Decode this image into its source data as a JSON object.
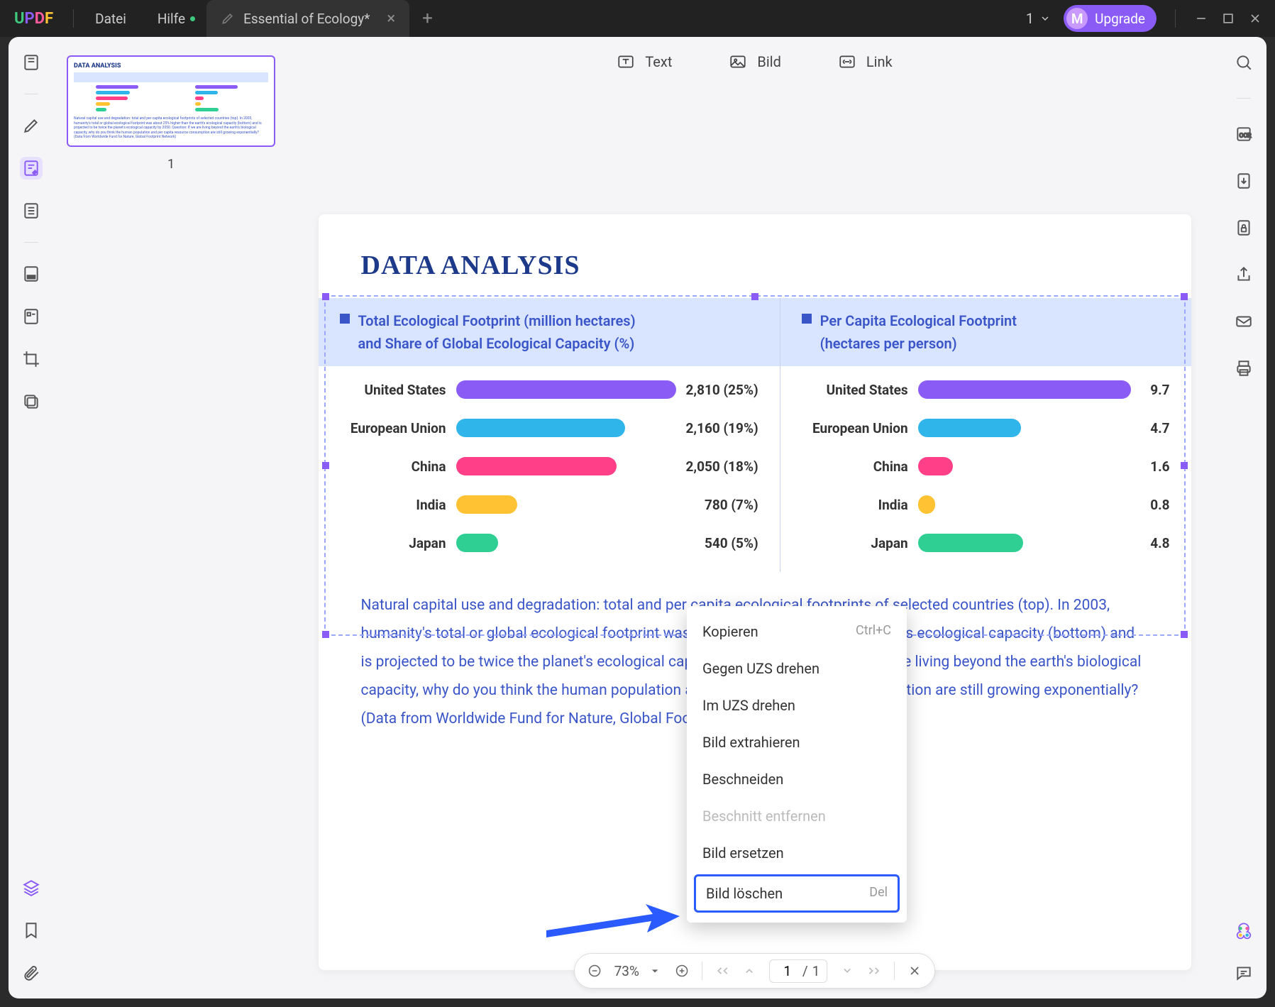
{
  "titlebar": {
    "menu_file": "Datei",
    "menu_help": "Hilfe",
    "tab_title": "Essential of Ecology*",
    "page_indicator": "1",
    "upgrade_avatar": "M",
    "upgrade_label": "Upgrade"
  },
  "edit_bar": {
    "text": "Text",
    "image": "Bild",
    "link": "Link"
  },
  "thumbnails": {
    "page1_num": "1"
  },
  "pager": {
    "zoom": "73%",
    "page_current": "1",
    "page_sep": "/",
    "page_total": "1"
  },
  "context_menu": {
    "copy": "Kopieren",
    "copy_shortcut": "Ctrl+C",
    "rotate_ccw": "Gegen UZS drehen",
    "rotate_cw": "Im UZS drehen",
    "extract": "Bild extrahieren",
    "crop": "Beschneiden",
    "remove_crop": "Beschnitt entfernen",
    "replace": "Bild ersetzen",
    "delete": "Bild löschen",
    "delete_shortcut": "Del"
  },
  "document": {
    "title": "DATA ANALYSIS",
    "legend_left_l1": "Total Ecological Footprint (million hectares)",
    "legend_left_l2": "and Share of Global Ecological Capacity (%)",
    "legend_right_l1": "Per Capita Ecological Footprint",
    "legend_right_l2": "(hectares per person)",
    "paragraph": "Natural capital use and degradation: total and per capita ecological footprints of selected countries (top). In 2003, humanity's total or global ecological footprint was about 25% higher than the earth's ecological capacity (bottom) and is projected to be twice the planet's ecological capacity by 2050. Question: If we are living beyond the earth's biological capacity, why do you think the human population and per capita resource consumption are still growing exponentially? (Data from Worldwide Fund for Nature, Global Footprint Network)"
  },
  "chart_data": [
    {
      "type": "bar",
      "title": "Total Ecological Footprint (million hectares) and Share of Global Ecological Capacity (%)",
      "categories": [
        "United States",
        "European Union",
        "China",
        "India",
        "Japan"
      ],
      "values": [
        2810,
        2160,
        2050,
        780,
        540
      ],
      "share_percent": [
        25,
        19,
        18,
        7,
        5
      ],
      "value_labels": [
        "2,810 (25%)",
        "2,160 (19%)",
        "2,050 (18%)",
        "780 (7%)",
        "540 (5%)"
      ],
      "xlabel": "",
      "ylabel": "",
      "ylim": [
        0,
        2810
      ]
    },
    {
      "type": "bar",
      "title": "Per Capita Ecological Footprint (hectares per person)",
      "categories": [
        "United States",
        "European Union",
        "China",
        "India",
        "Japan"
      ],
      "values": [
        9.7,
        4.7,
        1.6,
        0.8,
        4.8
      ],
      "value_labels": [
        "9.7",
        "4.7",
        "1.6",
        "0.8",
        "4.8"
      ],
      "xlabel": "",
      "ylabel": "",
      "ylim": [
        0,
        9.7
      ]
    }
  ],
  "colors": {
    "us": "#8a5cf5",
    "eu": "#2fb5ea",
    "cn": "#ff3f87",
    "in": "#ffc233",
    "jp": "#2fcf94"
  }
}
